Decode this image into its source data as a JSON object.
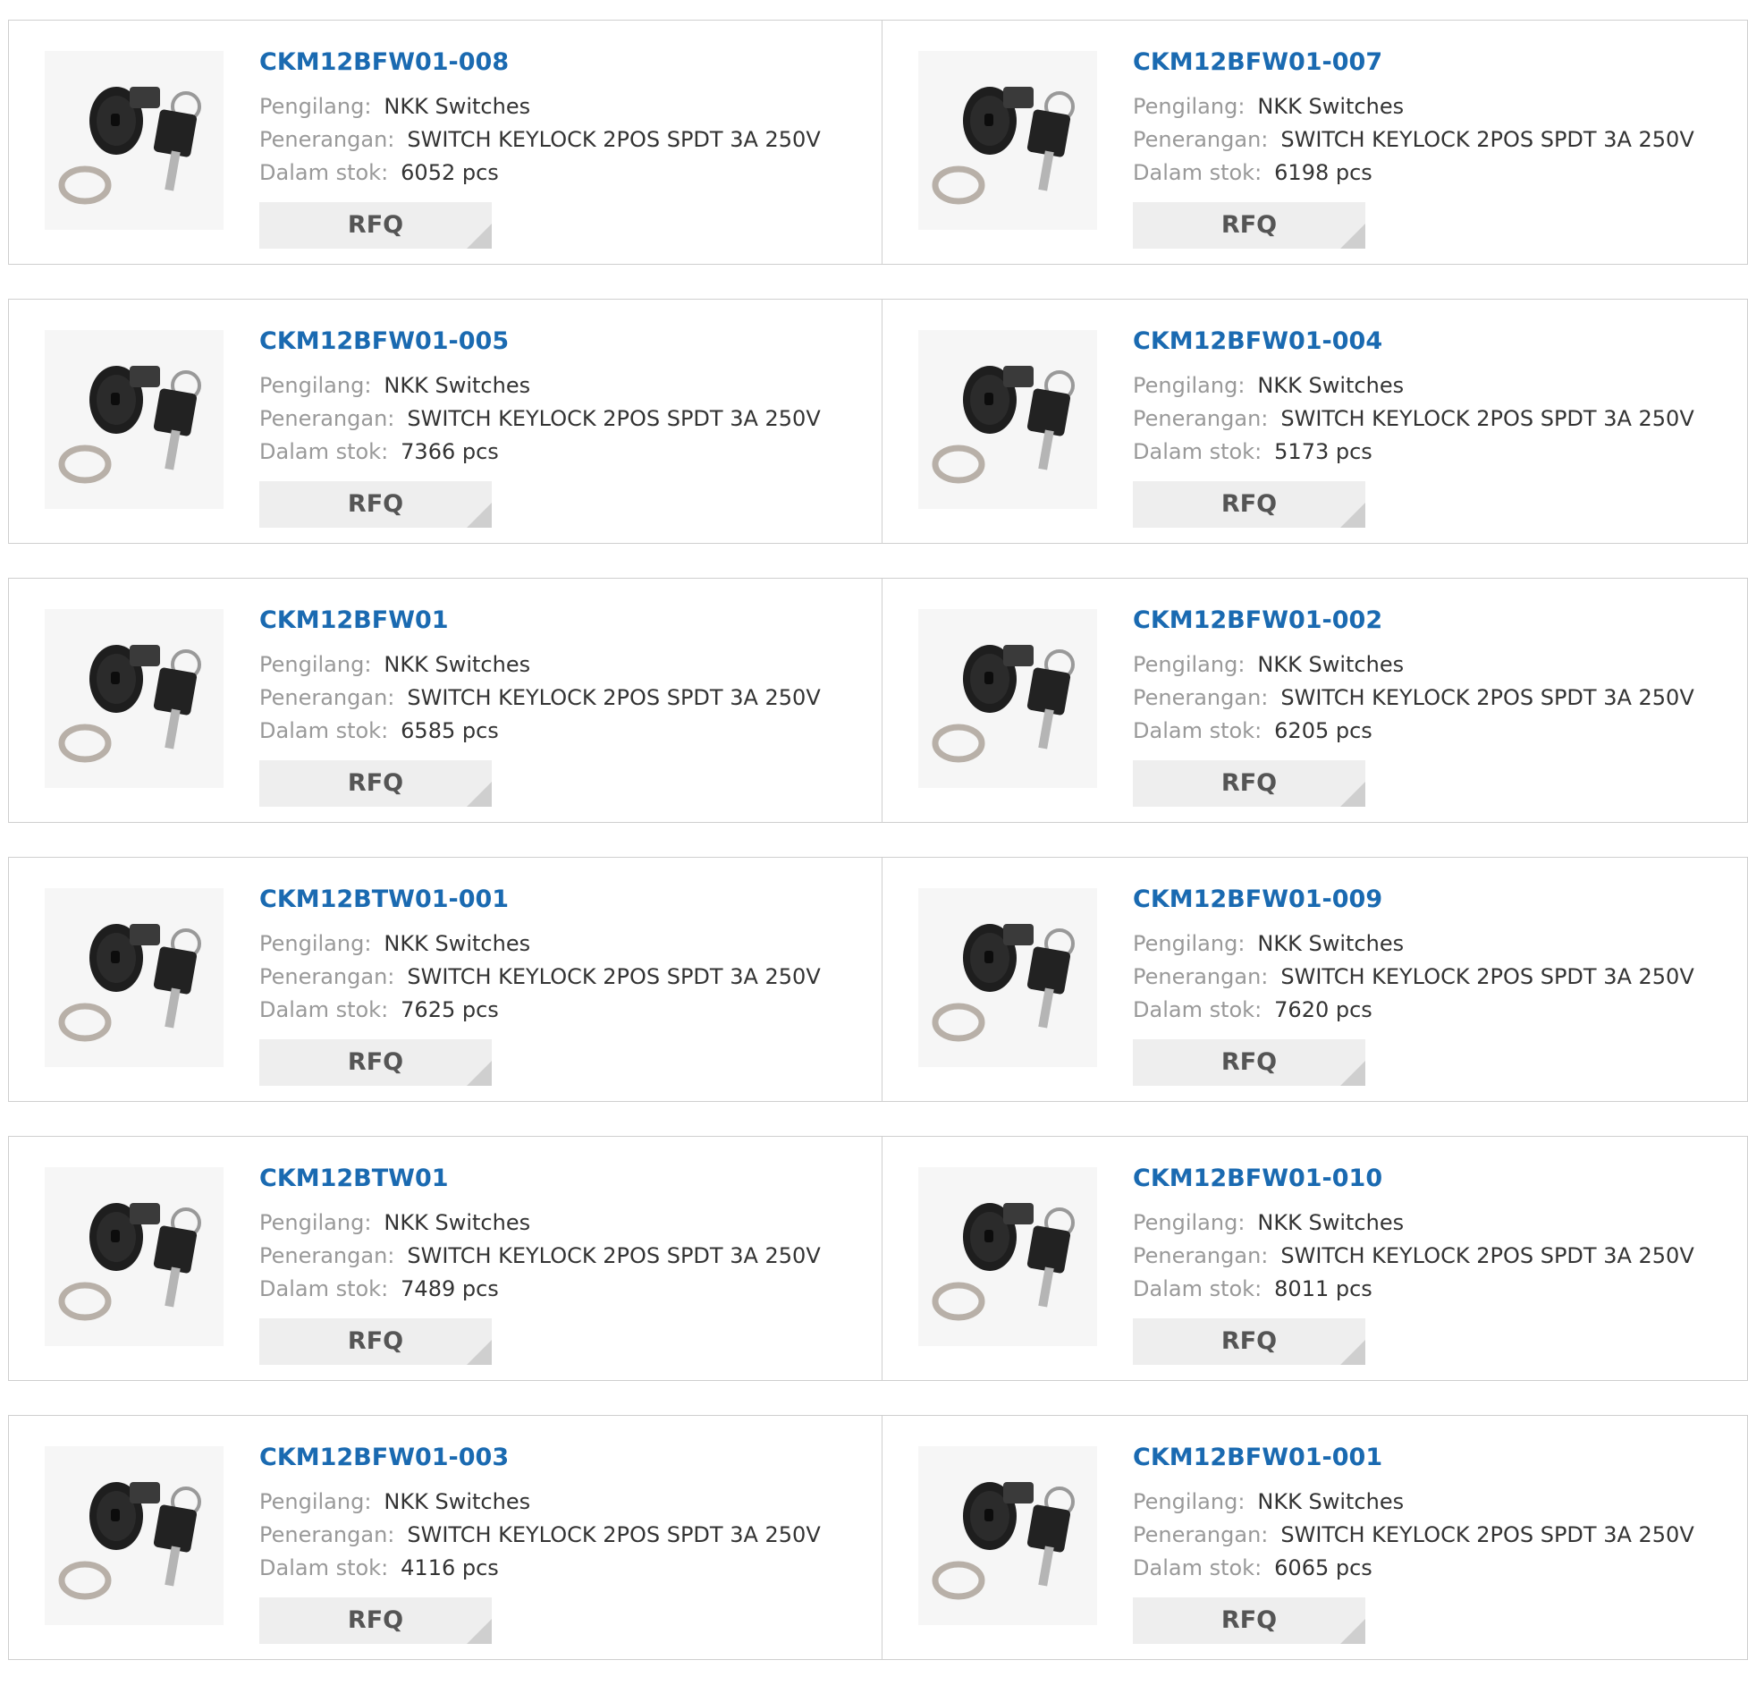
{
  "labels": {
    "manufacturer": "Pengilang:",
    "description": "Penerangan:",
    "stock": "Dalam stok:",
    "rfq": "RFQ"
  },
  "products": [
    {
      "part": "CKM12BFW01-008",
      "manufacturer": "NKK Switches",
      "description": "SWITCH KEYLOCK 2POS SPDT 3A 250V",
      "stock": "6052 pcs",
      "image": "keylock-switch-photo"
    },
    {
      "part": "CKM12BFW01-007",
      "manufacturer": "NKK Switches",
      "description": "SWITCH KEYLOCK 2POS SPDT 3A 250V",
      "stock": "6198 pcs",
      "image": "keylock-switch-photo"
    },
    {
      "part": "CKM12BFW01-005",
      "manufacturer": "NKK Switches",
      "description": "SWITCH KEYLOCK 2POS SPDT 3A 250V",
      "stock": "7366 pcs",
      "image": "keylock-switch-photo"
    },
    {
      "part": "CKM12BFW01-004",
      "manufacturer": "NKK Switches",
      "description": "SWITCH KEYLOCK 2POS SPDT 3A 250V",
      "stock": "5173 pcs",
      "image": "keylock-switch-photo"
    },
    {
      "part": "CKM12BFW01",
      "manufacturer": "NKK Switches",
      "description": "SWITCH KEYLOCK 2POS SPDT 3A 250V",
      "stock": "6585 pcs",
      "image": "keylock-switch-photo"
    },
    {
      "part": "CKM12BFW01-002",
      "manufacturer": "NKK Switches",
      "description": "SWITCH KEYLOCK 2POS SPDT 3A 250V",
      "stock": "6205 pcs",
      "image": "keylock-switch-photo"
    },
    {
      "part": "CKM12BTW01-001",
      "manufacturer": "NKK Switches",
      "description": "SWITCH KEYLOCK 2POS SPDT 3A 250V",
      "stock": "7625 pcs",
      "image": "keylock-switch-photo"
    },
    {
      "part": "CKM12BFW01-009",
      "manufacturer": "NKK Switches",
      "description": "SWITCH KEYLOCK 2POS SPDT 3A 250V",
      "stock": "7620 pcs",
      "image": "keylock-switch-photo"
    },
    {
      "part": "CKM12BTW01",
      "manufacturer": "NKK Switches",
      "description": "SWITCH KEYLOCK 2POS SPDT 3A 250V",
      "stock": "7489 pcs",
      "image": "keylock-switch-photo"
    },
    {
      "part": "CKM12BFW01-010",
      "manufacturer": "NKK Switches",
      "description": "SWITCH KEYLOCK 2POS SPDT 3A 250V",
      "stock": "8011 pcs",
      "image": "keylock-switch-photo"
    },
    {
      "part": "CKM12BFW01-003",
      "manufacturer": "NKK Switches",
      "description": "SWITCH KEYLOCK 2POS SPDT 3A 250V",
      "stock": "4116 pcs",
      "image": "keylock-switch-photo"
    },
    {
      "part": "CKM12BFW01-001",
      "manufacturer": "NKK Switches",
      "description": "SWITCH KEYLOCK 2POS SPDT 3A 250V",
      "stock": "6065 pcs",
      "image": "keylock-switch-photo"
    }
  ],
  "colors": {
    "part_link": "#1a6ab1",
    "label": "#999999",
    "value": "#333333",
    "rfq_bg": "#eeeeee",
    "border": "#cfcfcf"
  }
}
